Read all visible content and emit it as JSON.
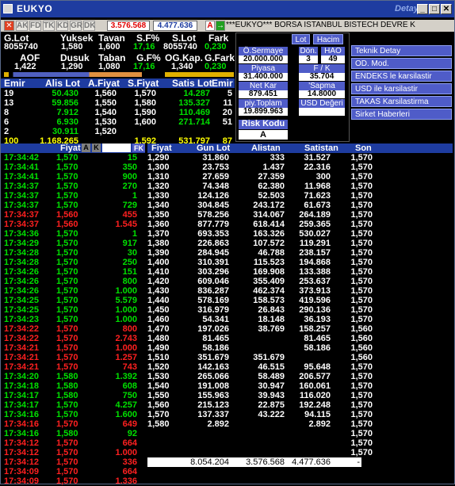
{
  "window": {
    "title": "EUKYO",
    "detay": "Detay",
    "min": "_",
    "max": "□",
    "close": "✕"
  },
  "toolbar": {
    "close_x": "✕",
    "tabs": [
      "AK",
      "FD",
      "TK",
      "KD",
      "GR",
      "DK"
    ],
    "value1": "3.576.568",
    "value2": "4.477.636",
    "a_btn": "A",
    "arrow": "→",
    "marquee": "***EUKYO*** BORSA ISTANBUL BISTECH DEVRE K"
  },
  "colors": {
    "title_bar": "#1e3ca0",
    "panel_blue": "#4f5cc8",
    "up": "#00e000",
    "down": "#ff2020",
    "flat": "#ffffff",
    "yellow": "#ffff00"
  },
  "summary": {
    "row1_headers": [
      "G.Lot",
      "Yuksek",
      "Tavan",
      "S.F%",
      "S.Lot",
      "Fark"
    ],
    "row1_values": [
      "8055740",
      "1,580",
      "1,600",
      "17,16",
      "8055740",
      "0,230"
    ],
    "row2_headers": [
      "AOF",
      "Dusuk",
      "Taban",
      "G.F%",
      "OG.Kap.",
      "G.Fark"
    ],
    "row2_values": [
      "1,422",
      "1,290",
      "1,080",
      "17,16",
      "1,340",
      "0,230"
    ]
  },
  "depth": {
    "headers": [
      "Emir",
      "Alis Lot",
      "A.Fiyat",
      "S.Fiyat",
      "Satis Lot",
      "Emir"
    ],
    "rows": [
      [
        "19",
        "50.430",
        "1,560",
        "1,570",
        "14.287",
        "5"
      ],
      [
        "13",
        "59.856",
        "1,550",
        "1,580",
        "135.327",
        "11"
      ],
      [
        "8",
        "7.912",
        "1,540",
        "1,590",
        "110.469",
        "20"
      ],
      [
        "6",
        "6.930",
        "1,530",
        "1,600",
        "271.714",
        "51"
      ],
      [
        "2",
        "30.911",
        "1,520",
        "",
        "",
        ""
      ]
    ],
    "totals": [
      "100",
      "1.168.265",
      "",
      "1,592",
      "531.797",
      "87"
    ]
  },
  "panel": {
    "lot_btn": "Lot",
    "hacim_btn": "Hacim",
    "fields": [
      {
        "label": "Ö.Sermaye",
        "value": "20.000.000"
      },
      {
        "label": "Dön.",
        "value": "3"
      },
      {
        "label": "HAO",
        "value": "49"
      },
      {
        "label": "Piyasa Değeri",
        "value": "31.400.000"
      },
      {
        "label": "F / K",
        "value": "35.704"
      },
      {
        "label": "Net Kar",
        "value": "879.451"
      },
      {
        "label": "'Sapma",
        "value": "14.8000"
      },
      {
        "label": "piy.Toplam Lot",
        "value": "19.899.963"
      },
      {
        "label": "USD Değeri",
        "value": ""
      },
      {
        "label": "Risk Kodu",
        "value": "A"
      }
    ],
    "side_buttons": [
      "Teknik Detay",
      "OD. Mod.",
      "ENDEKS le karsilastir",
      "USD ile karsilastir",
      "TAKAS Karsilastirma",
      "Sirket Haberleri"
    ]
  },
  "trades": {
    "headers": {
      "fiyat": "Fiyat",
      "a": "A",
      "k": "K",
      "fk": "FK"
    },
    "rows": [
      [
        "17:34:42",
        "1,570",
        "15",
        "up"
      ],
      [
        "17:34:41",
        "1,570",
        "350",
        "up"
      ],
      [
        "17:34:41",
        "1,570",
        "900",
        "up"
      ],
      [
        "17:34:37",
        "1,570",
        "270",
        "up"
      ],
      [
        "17:34:37",
        "1,570",
        "1",
        "up"
      ],
      [
        "17:34:37",
        "1,570",
        "729",
        "up"
      ],
      [
        "17:34:37",
        "1,560",
        "455",
        "down"
      ],
      [
        "17:34:37",
        "1,560",
        "1.545",
        "down"
      ],
      [
        "17:34:36",
        "1,570",
        "1",
        "up"
      ],
      [
        "17:34:29",
        "1,570",
        "917",
        "up"
      ],
      [
        "17:34:28",
        "1,570",
        "30",
        "up"
      ],
      [
        "17:34:28",
        "1,570",
        "250",
        "up"
      ],
      [
        "17:34:26",
        "1,570",
        "151",
        "up"
      ],
      [
        "17:34:26",
        "1,570",
        "800",
        "up"
      ],
      [
        "17:34:26",
        "1,570",
        "1.000",
        "up"
      ],
      [
        "17:34:25",
        "1,570",
        "5.579",
        "up"
      ],
      [
        "17:34:25",
        "1,570",
        "1.000",
        "up"
      ],
      [
        "17:34:23",
        "1,570",
        "1.000",
        "up"
      ],
      [
        "17:34:22",
        "1,570",
        "800",
        "down"
      ],
      [
        "17:34:22",
        "1,570",
        "2.743",
        "down"
      ],
      [
        "17:34:21",
        "1,570",
        "1.000",
        "down"
      ],
      [
        "17:34:21",
        "1,570",
        "1.257",
        "down"
      ],
      [
        "17:34:21",
        "1,570",
        "743",
        "down"
      ],
      [
        "17:34:20",
        "1,580",
        "1.392",
        "up"
      ],
      [
        "17:34:18",
        "1,580",
        "608",
        "up"
      ],
      [
        "17:34:17",
        "1,580",
        "750",
        "up"
      ],
      [
        "17:34:17",
        "1,570",
        "4.257",
        "up"
      ],
      [
        "17:34:16",
        "1,570",
        "1.600",
        "up"
      ],
      [
        "17:34:16",
        "1,570",
        "649",
        "down"
      ],
      [
        "17:34:16",
        "1,580",
        "92",
        "up"
      ],
      [
        "17:34:12",
        "1,570",
        "664",
        "down"
      ],
      [
        "17:34:12",
        "1,570",
        "1.000",
        "down"
      ],
      [
        "17:34:12",
        "1,570",
        "336",
        "down"
      ],
      [
        "17:34:09",
        "1,570",
        "664",
        "down"
      ],
      [
        "17:34:09",
        "1,570",
        "1.336",
        "down"
      ]
    ]
  },
  "distribution": {
    "headers": [
      "Fiyat",
      "Gun Lot",
      "Alistan",
      "Satistan",
      "Son"
    ],
    "rows": [
      [
        "1,290",
        "31.860",
        "333",
        "31.527",
        "1,570"
      ],
      [
        "1,300",
        "23.753",
        "1.437",
        "22.316",
        "1,570"
      ],
      [
        "1,310",
        "27.659",
        "27.359",
        "300",
        "1,570"
      ],
      [
        "1,320",
        "74.348",
        "62.380",
        "11.968",
        "1,570"
      ],
      [
        "1,330",
        "124.126",
        "52.503",
        "71.623",
        "1,570"
      ],
      [
        "1,340",
        "304.845",
        "243.172",
        "61.673",
        "1,570"
      ],
      [
        "1,350",
        "578.256",
        "314.067",
        "264.189",
        "1,570"
      ],
      [
        "1,360",
        "877.779",
        "618.414",
        "259.365",
        "1,570"
      ],
      [
        "1,370",
        "693.353",
        "163.326",
        "530.027",
        "1,570"
      ],
      [
        "1,380",
        "226.863",
        "107.572",
        "119.291",
        "1,570"
      ],
      [
        "1,390",
        "284.945",
        "46.788",
        "238.157",
        "1,570"
      ],
      [
        "1,400",
        "310.391",
        "115.523",
        "194.868",
        "1,570"
      ],
      [
        "1,410",
        "303.296",
        "169.908",
        "133.388",
        "1,570"
      ],
      [
        "1,420",
        "609.046",
        "355.409",
        "253.637",
        "1,570"
      ],
      [
        "1,430",
        "836.287",
        "462.374",
        "373.913",
        "1,570"
      ],
      [
        "1,440",
        "578.169",
        "158.573",
        "419.596",
        "1,570"
      ],
      [
        "1,450",
        "316.979",
        "26.843",
        "290.136",
        "1,570"
      ],
      [
        "1,460",
        "54.341",
        "18.148",
        "36.193",
        "1,570"
      ],
      [
        "1,470",
        "197.026",
        "38.769",
        "158.257",
        "1,560"
      ],
      [
        "1,480",
        "81.465",
        "",
        "81.465",
        "1,560"
      ],
      [
        "1,490",
        "58.186",
        "",
        "58.186",
        "1,560"
      ],
      [
        "1,510",
        "351.679",
        "351.679",
        "",
        "1,560"
      ],
      [
        "1,520",
        "142.163",
        "46.515",
        "95.648",
        "1,570"
      ],
      [
        "1,530",
        "265.066",
        "58.489",
        "206.577",
        "1,570"
      ],
      [
        "1,540",
        "191.008",
        "30.947",
        "160.061",
        "1,570"
      ],
      [
        "1,550",
        "155.963",
        "39.943",
        "116.020",
        "1,570"
      ],
      [
        "1,560",
        "215.123",
        "22.875",
        "192.248",
        "1,570"
      ],
      [
        "1,570",
        "137.337",
        "43.222",
        "94.115",
        "1,570"
      ],
      [
        "1,580",
        "2.892",
        "",
        "2.892",
        "1,570"
      ],
      [
        "",
        "",
        "",
        "",
        "1,570"
      ],
      [
        "",
        "",
        "",
        "",
        "1,570"
      ],
      [
        "",
        "",
        "",
        "",
        "1,570"
      ],
      [
        "",
        "",
        "",
        "",
        "1,570"
      ],
      [
        "",
        "",
        "",
        "",
        "1,570"
      ]
    ],
    "totals": {
      "gun": "8.054.204",
      "alistan": "3.576.568",
      "satistan": "4.477.636",
      "dash": "-"
    }
  }
}
